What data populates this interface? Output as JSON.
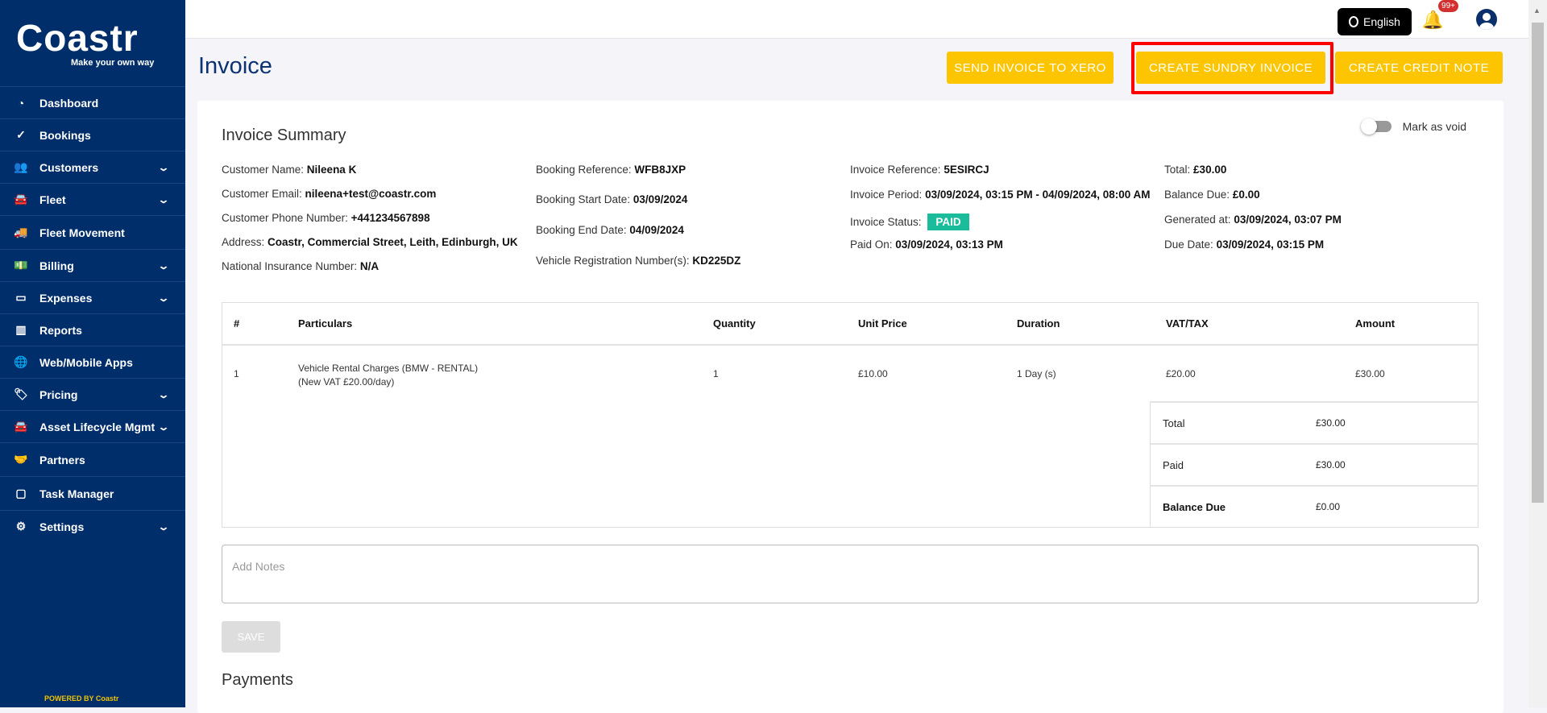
{
  "brand": {
    "name": "Coastr",
    "tagline": "Make your own way",
    "powered": "POWERED BY Coastr"
  },
  "sidebar": {
    "items": [
      {
        "label": "Dashboard",
        "icon": "gauge-icon",
        "glyph": "◔",
        "chevron": false
      },
      {
        "label": "Bookings",
        "icon": "check-circle-icon",
        "glyph": "✓",
        "chevron": false
      },
      {
        "label": "Customers",
        "icon": "users-icon",
        "glyph": "👥",
        "chevron": true
      },
      {
        "label": "Fleet",
        "icon": "car-icon",
        "glyph": "🚘",
        "chevron": true
      },
      {
        "label": "Fleet Movement",
        "icon": "truck-icon",
        "glyph": "🚚",
        "chevron": false
      },
      {
        "label": "Billing",
        "icon": "money-icon",
        "glyph": "💵",
        "chevron": true
      },
      {
        "label": "Expenses",
        "icon": "credit-card-icon",
        "glyph": "▭",
        "chevron": true
      },
      {
        "label": "Reports",
        "icon": "chart-icon",
        "glyph": "▥",
        "chevron": false
      },
      {
        "label": "Web/Mobile Apps",
        "icon": "globe-icon",
        "glyph": "🌐",
        "chevron": false
      },
      {
        "label": "Pricing",
        "icon": "tag-icon",
        "glyph": "🏷",
        "chevron": true
      },
      {
        "label": "Asset Lifecycle Mgmt",
        "icon": "car-icon",
        "glyph": "🚘",
        "chevron": true
      },
      {
        "label": "Partners",
        "icon": "handshake-icon",
        "glyph": "🤝",
        "chevron": false
      },
      {
        "label": "Task Manager",
        "icon": "calendar-icon",
        "glyph": "▢",
        "chevron": false
      },
      {
        "label": "Settings",
        "icon": "gear-icon",
        "glyph": "⚙",
        "chevron": true
      }
    ]
  },
  "topbar": {
    "language": "English",
    "notifications": "99+"
  },
  "page": {
    "title": "Invoice",
    "buttons": {
      "xero": "SEND INVOICE TO XERO",
      "sundry": "CREATE SUNDRY INVOICE",
      "credit": "CREATE CREDIT NOTE"
    }
  },
  "summary": {
    "title": "Invoice Summary",
    "void_label": "Mark as void",
    "col1": [
      [
        "Customer Name:",
        "Nileena K"
      ],
      [
        "Customer Email:",
        "nileena+test@coastr.com"
      ],
      [
        "Customer Phone Number:",
        "+441234567898"
      ],
      [
        "Address:",
        "Coastr, Commercial Street, Leith, Edinburgh, UK"
      ],
      [
        "National Insurance Number:",
        "N/A"
      ]
    ],
    "col2": [
      [
        "Booking Reference:",
        "WFB8JXP"
      ],
      [
        "Booking Start Date:",
        "03/09/2024"
      ],
      [
        "Booking End Date:",
        "04/09/2024"
      ],
      [
        "Vehicle Registration Number(s):",
        "KD225DZ"
      ]
    ],
    "col3": [
      [
        "Invoice Reference:",
        "5ESIRCJ"
      ],
      [
        "Invoice Period:",
        "03/09/2024, 03:15 PM - 04/09/2024, 08:00 AM"
      ],
      [
        "Invoice Status:",
        "PAID"
      ],
      [
        "Paid On:",
        "03/09/2024, 03:13 PM"
      ]
    ],
    "col4": [
      [
        "Total:",
        "£30.00"
      ],
      [
        "Balance Due:",
        "£0.00"
      ],
      [
        "Generated at:",
        "03/09/2024, 03:07 PM"
      ],
      [
        "Due Date:",
        "03/09/2024, 03:15 PM"
      ]
    ]
  },
  "table": {
    "headers": [
      "#",
      "Particulars",
      "Quantity",
      "Unit Price",
      "Duration",
      "VAT/TAX",
      "Amount"
    ],
    "rows": [
      {
        "num": "1",
        "particulars": "Vehicle Rental Charges (BMW - RENTAL)",
        "sub": "(New VAT £20.00/day)",
        "qty": "1",
        "unit": "£10.00",
        "duration": "1 Day (s)",
        "vat": "£20.00",
        "amount": "£30.00"
      }
    ],
    "totals": [
      [
        "Total",
        "£30.00"
      ],
      [
        "Paid",
        "£30.00"
      ],
      [
        "Balance Due",
        "£0.00"
      ]
    ]
  },
  "notes": {
    "placeholder": "Add Notes"
  },
  "save_label": "SAVE",
  "payments_title": "Payments"
}
